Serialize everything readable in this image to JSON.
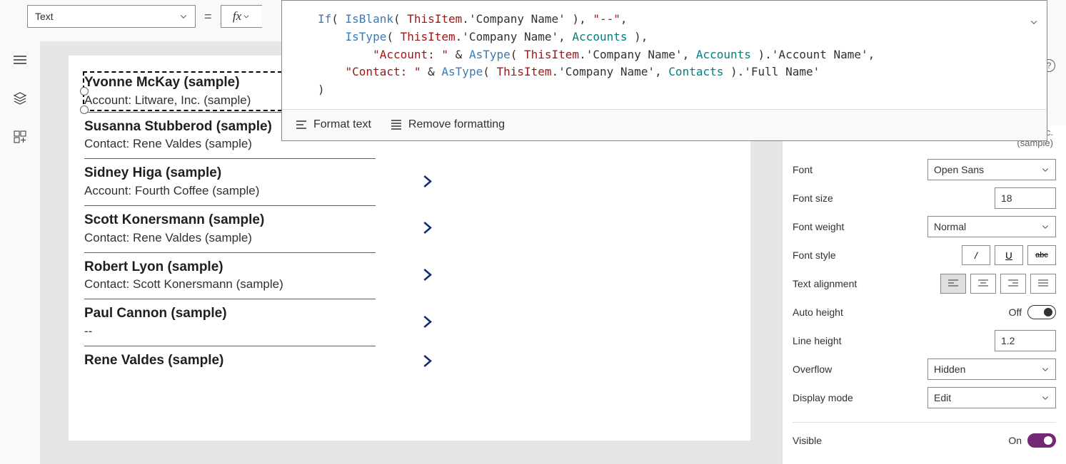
{
  "propertyDropdown": "Text",
  "formula": {
    "tokens": [
      [
        {
          "t": "If",
          "c": "tok-fn"
        },
        {
          "t": "( ",
          "c": ""
        },
        {
          "t": "IsBlank",
          "c": "tok-fn"
        },
        {
          "t": "( ",
          "c": ""
        },
        {
          "t": "ThisItem",
          "c": "tok-id"
        },
        {
          "t": ".",
          "c": ""
        },
        {
          "t": "'Company Name'",
          "c": "tok-prop"
        },
        {
          "t": " ), ",
          "c": ""
        },
        {
          "t": "\"--\"",
          "c": "tok-str"
        },
        {
          "t": ",",
          "c": ""
        }
      ],
      [
        {
          "t": "    ",
          "c": ""
        },
        {
          "t": "IsType",
          "c": "tok-fn"
        },
        {
          "t": "( ",
          "c": ""
        },
        {
          "t": "ThisItem",
          "c": "tok-id"
        },
        {
          "t": ".",
          "c": ""
        },
        {
          "t": "'Company Name'",
          "c": "tok-prop"
        },
        {
          "t": ", ",
          "c": ""
        },
        {
          "t": "Accounts",
          "c": "tok-type"
        },
        {
          "t": " ),",
          "c": ""
        }
      ],
      [
        {
          "t": "        ",
          "c": ""
        },
        {
          "t": "\"Account: \"",
          "c": "tok-str"
        },
        {
          "t": " & ",
          "c": ""
        },
        {
          "t": "AsType",
          "c": "tok-fn"
        },
        {
          "t": "( ",
          "c": ""
        },
        {
          "t": "ThisItem",
          "c": "tok-id"
        },
        {
          "t": ".",
          "c": ""
        },
        {
          "t": "'Company Name'",
          "c": "tok-prop"
        },
        {
          "t": ", ",
          "c": ""
        },
        {
          "t": "Accounts",
          "c": "tok-type"
        },
        {
          "t": " ).",
          "c": ""
        },
        {
          "t": "'Account Name'",
          "c": "tok-prop"
        },
        {
          "t": ",",
          "c": ""
        }
      ],
      [
        {
          "t": "    ",
          "c": ""
        },
        {
          "t": "\"Contact: \"",
          "c": "tok-str"
        },
        {
          "t": " & ",
          "c": ""
        },
        {
          "t": "AsType",
          "c": "tok-fn"
        },
        {
          "t": "( ",
          "c": ""
        },
        {
          "t": "ThisItem",
          "c": "tok-id"
        },
        {
          "t": ".",
          "c": ""
        },
        {
          "t": "'Company Name'",
          "c": "tok-prop"
        },
        {
          "t": ", ",
          "c": ""
        },
        {
          "t": "Contacts",
          "c": "tok-type"
        },
        {
          "t": " ).",
          "c": ""
        },
        {
          "t": "'Full Name'",
          "c": "tok-prop"
        }
      ],
      [
        {
          "t": ")",
          "c": ""
        }
      ]
    ]
  },
  "toolbar": {
    "format": "Format text",
    "remove": "Remove formatting"
  },
  "gallery": [
    {
      "title": "Yvonne McKay (sample)",
      "sub": "Account: Litware, Inc. (sample)",
      "selected": true
    },
    {
      "title": "Susanna Stubberod (sample)",
      "sub": "Contact: Rene Valdes (sample)"
    },
    {
      "title": "Sidney Higa (sample)",
      "sub": "Account: Fourth Coffee (sample)"
    },
    {
      "title": "Scott Konersmann (sample)",
      "sub": "Contact: Rene Valdes (sample)"
    },
    {
      "title": "Robert Lyon (sample)",
      "sub": "Contact: Scott Konersmann (sample)"
    },
    {
      "title": "Paul Cannon (sample)",
      "sub": "--"
    },
    {
      "title": "Rene Valdes (sample)",
      "sub": ""
    }
  ],
  "props": {
    "textLabel": "Text",
    "textValue": "Account: Litware, Inc. (sample)",
    "fontLabel": "Font",
    "fontValue": "Open Sans",
    "fontSizeLabel": "Font size",
    "fontSizeValue": "18",
    "fontWeightLabel": "Font weight",
    "fontWeightValue": "Normal",
    "fontStyleLabel": "Font style",
    "textAlignLabel": "Text alignment",
    "autoHeightLabel": "Auto height",
    "autoHeightValue": "Off",
    "lineHeightLabel": "Line height",
    "lineHeightValue": "1.2",
    "overflowLabel": "Overflow",
    "overflowValue": "Hidden",
    "displayModeLabel": "Display mode",
    "displayModeValue": "Edit",
    "visibleLabel": "Visible",
    "visibleValue": "On"
  }
}
